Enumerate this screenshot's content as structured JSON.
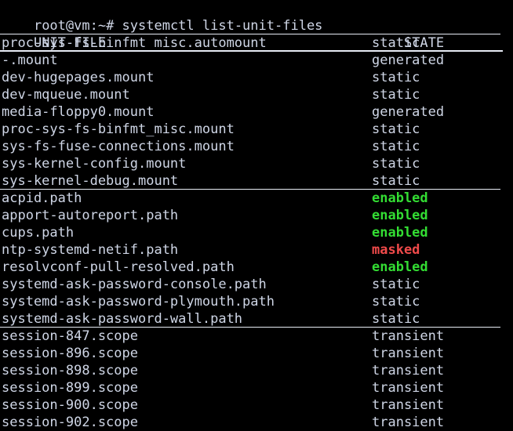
{
  "terminal": {
    "app": "terminal",
    "background_color": "#000000",
    "foreground_color": "#cfd6e6",
    "enabled_color": "#33dd33",
    "masked_color": "#f04a4a",
    "prompt": "root@vm:~# ",
    "command": "systemctl list-unit-files",
    "prompt_line": "root@vm:~# systemctl list-unit-files",
    "header": {
      "unit_file": "UNIT FILE",
      "state": "STATE"
    },
    "rows": [
      {
        "unit": "proc-sys-fs-binfmt misc.automount",
        "state": "static",
        "state_class": "st-static",
        "rule": "thick"
      },
      {
        "unit": "-.mount",
        "state": "generated",
        "state_class": "st-generated",
        "rule": "none"
      },
      {
        "unit": "dev-hugepages.mount",
        "state": "static",
        "state_class": "st-static",
        "rule": "none"
      },
      {
        "unit": "dev-mqueue.mount",
        "state": "static",
        "state_class": "st-static",
        "rule": "none"
      },
      {
        "unit": "media-floppy0.mount",
        "state": "generated",
        "state_class": "st-generated",
        "rule": "none"
      },
      {
        "unit": "proc-sys-fs-binfmt_misc.mount",
        "state": "static",
        "state_class": "st-static",
        "rule": "none"
      },
      {
        "unit": "sys-fs-fuse-connections.mount",
        "state": "static",
        "state_class": "st-static",
        "rule": "none"
      },
      {
        "unit": "sys-kernel-config.mount",
        "state": "static",
        "state_class": "st-static",
        "rule": "none"
      },
      {
        "unit": "sys-kernel-debug.mount",
        "state": "static",
        "state_class": "st-static",
        "rule": "thin"
      },
      {
        "unit": "acpid.path",
        "state": "enabled",
        "state_class": "st-enabled",
        "rule": "none"
      },
      {
        "unit": "apport-autoreport.path",
        "state": "enabled",
        "state_class": "st-enabled",
        "rule": "none"
      },
      {
        "unit": "cups.path",
        "state": "enabled",
        "state_class": "st-enabled",
        "rule": "none"
      },
      {
        "unit": "ntp-systemd-netif.path",
        "state": "masked",
        "state_class": "st-masked",
        "rule": "none"
      },
      {
        "unit": "resolvconf-pull-resolved.path",
        "state": "enabled",
        "state_class": "st-enabled",
        "rule": "none"
      },
      {
        "unit": "systemd-ask-password-console.path",
        "state": "static",
        "state_class": "st-static",
        "rule": "none"
      },
      {
        "unit": "systemd-ask-password-plymouth.path",
        "state": "static",
        "state_class": "st-static",
        "rule": "none"
      },
      {
        "unit": "systemd-ask-password-wall.path",
        "state": "static",
        "state_class": "st-static",
        "rule": "thin"
      },
      {
        "unit": "session-847.scope",
        "state": "transient",
        "state_class": "st-transient",
        "rule": "none"
      },
      {
        "unit": "session-896.scope",
        "state": "transient",
        "state_class": "st-transient",
        "rule": "none"
      },
      {
        "unit": "session-898.scope",
        "state": "transient",
        "state_class": "st-transient",
        "rule": "none"
      },
      {
        "unit": "session-899.scope",
        "state": "transient",
        "state_class": "st-transient",
        "rule": "none"
      },
      {
        "unit": "session-900.scope",
        "state": "transient",
        "state_class": "st-transient",
        "rule": "none"
      },
      {
        "unit": "session-902.scope",
        "state": "transient",
        "state_class": "st-transient",
        "rule": "none"
      }
    ]
  }
}
